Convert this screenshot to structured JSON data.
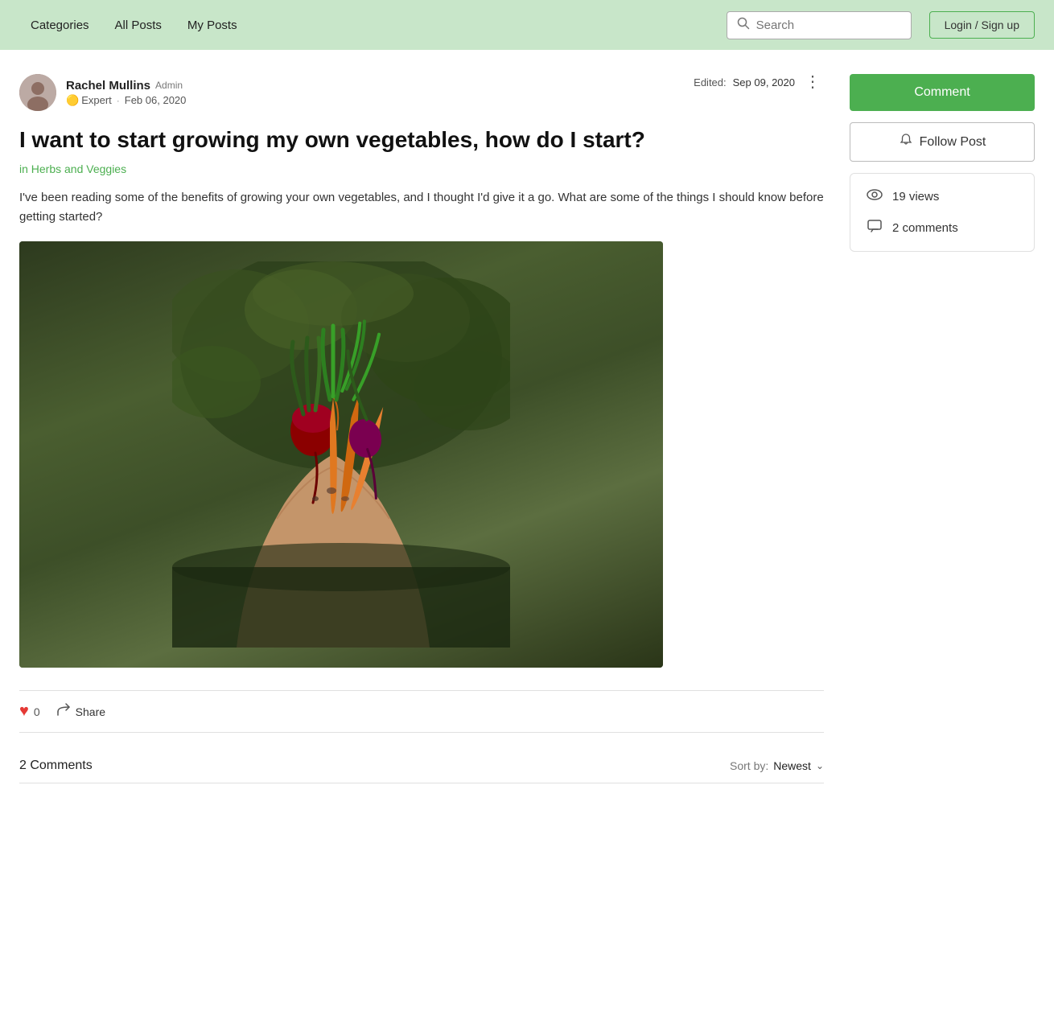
{
  "nav": {
    "links": [
      {
        "id": "categories",
        "label": "Categories"
      },
      {
        "id": "all-posts",
        "label": "All Posts"
      },
      {
        "id": "my-posts",
        "label": "My Posts"
      }
    ],
    "search": {
      "placeholder": "Search"
    },
    "login_label": "Login / Sign up"
  },
  "post": {
    "author": {
      "name": "Rachel Mullins",
      "role": "Admin",
      "expert_label": "Expert",
      "date": "Feb 06, 2020"
    },
    "edited": {
      "label": "Edited:",
      "date": "Sep 09, 2020"
    },
    "title": "I want to start growing my own vegetables, how do I start?",
    "category": "in Herbs and Veggies",
    "body": "I've been reading some of the benefits of growing your own vegetables, and I thought I'd give it a go. What are some of the things I should know before getting started?",
    "image_alt": "Hands holding freshly picked vegetables including carrots and beets"
  },
  "actions": {
    "like_count": "0",
    "share_label": "Share"
  },
  "comments_section": {
    "count_label": "2 Comments",
    "sort_label": "Sort by:",
    "sort_value": "Newest"
  },
  "sidebar": {
    "comment_btn": "Comment",
    "follow_btn": "Follow Post",
    "stats": {
      "views": "19 views",
      "comments": "2 comments"
    }
  }
}
